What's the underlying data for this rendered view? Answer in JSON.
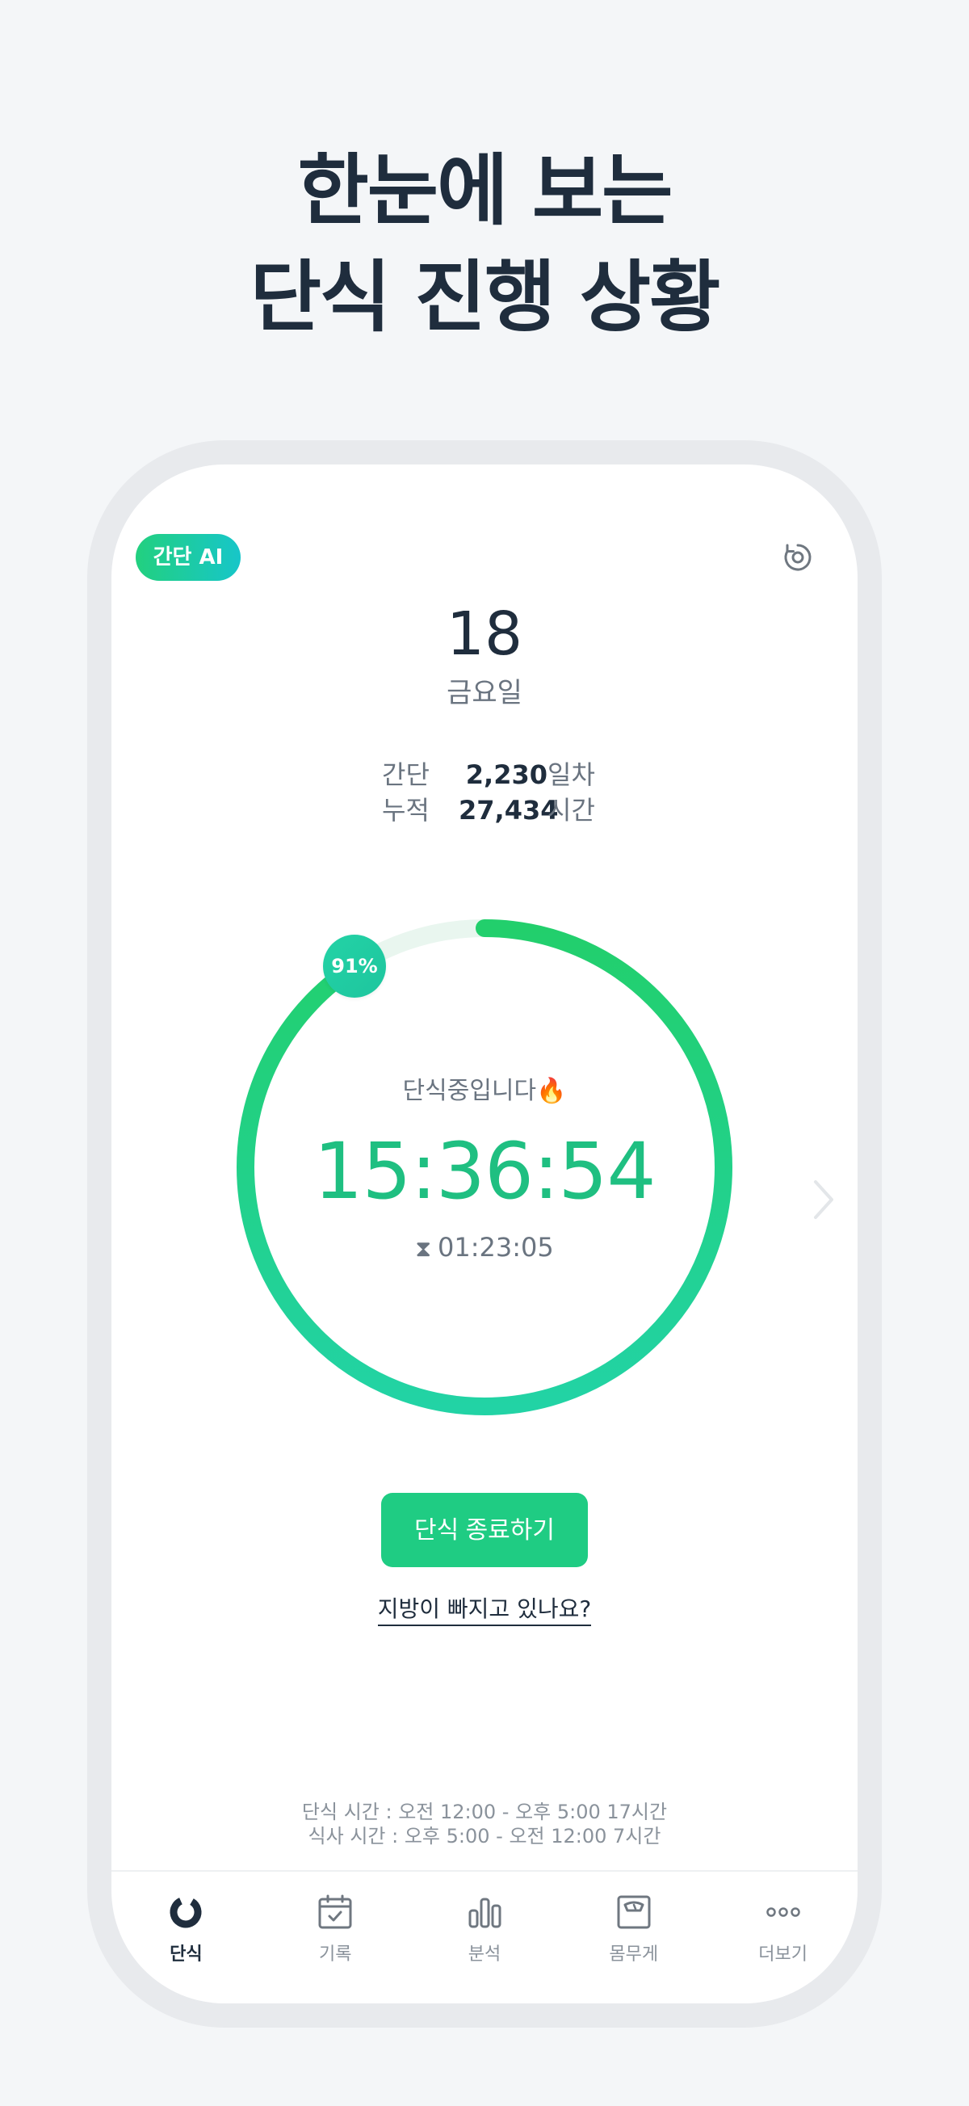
{
  "headline": {
    "line1": "한눈에 보는",
    "line2": "단식 진행 상황"
  },
  "header": {
    "badge": "간단 AI",
    "timer_icon": "timer-reset-icon"
  },
  "date": {
    "day": "18",
    "weekday": "금요일"
  },
  "stats": [
    {
      "label": "간단",
      "value": "2,230",
      "unit": "일차"
    },
    {
      "label": "누적",
      "value": "27,434",
      "unit": "시간"
    }
  ],
  "ring": {
    "progress": 0.91,
    "progress_label": "91%",
    "status": "단식중입니다🔥",
    "elapsed": "15:36:54",
    "remaining": "01:23:05",
    "colors": {
      "track": "#e9f6ef",
      "start": "#22d3a5",
      "end": "#22cf6c"
    }
  },
  "actions": {
    "end_button": "단식 종료하기",
    "fat_link": "지방이 빠지고 있나요?"
  },
  "schedule": {
    "fasting": "단식 시간 : 오전 12:00 - 오후 5:00 17시간",
    "eating": "식사 시간 : 오후 5:00 - 오전 12:00 7시간"
  },
  "tabs": [
    {
      "label": "단식",
      "icon": "fasting-ring-icon",
      "active": true
    },
    {
      "label": "기록",
      "icon": "calendar-icon",
      "active": false
    },
    {
      "label": "분석",
      "icon": "bar-chart-icon",
      "active": false
    },
    {
      "label": "몸무게",
      "icon": "scale-icon",
      "active": false
    },
    {
      "label": "더보기",
      "icon": "more-icon",
      "active": false
    }
  ]
}
